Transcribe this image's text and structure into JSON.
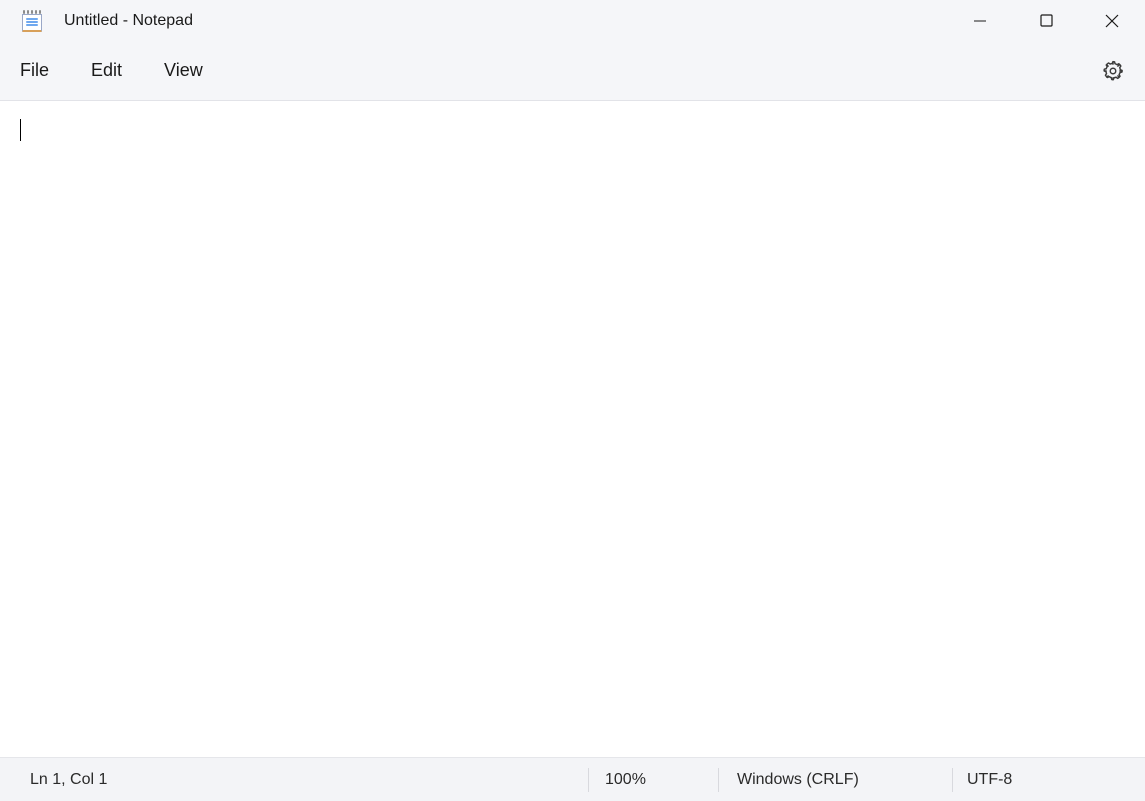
{
  "titlebar": {
    "title": "Untitled - Notepad"
  },
  "menubar": {
    "file": "File",
    "edit": "Edit",
    "view": "View"
  },
  "editor": {
    "content": ""
  },
  "statusbar": {
    "position": "Ln 1, Col 1",
    "zoom": "100%",
    "lineending": "Windows (CRLF)",
    "encoding": "UTF-8"
  }
}
